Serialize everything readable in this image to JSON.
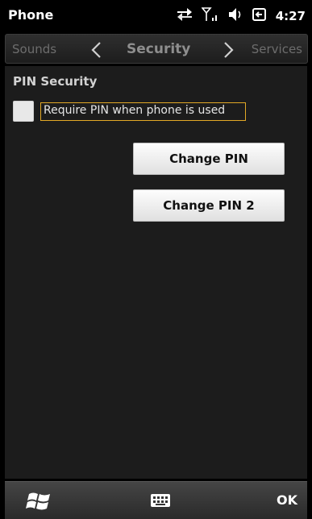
{
  "titlebar": {
    "app_title": "Phone",
    "clock": "4:27",
    "icons": [
      "data-transfer-icon",
      "signal-icon",
      "volume-icon",
      "battery-icon"
    ]
  },
  "tabs": {
    "previous": "Sounds",
    "current": "Security",
    "next": "Services"
  },
  "section": {
    "title": "PIN Security"
  },
  "require_pin": {
    "label": "Require PIN when phone is used",
    "checked": false
  },
  "buttons": {
    "change_pin": "Change PIN",
    "change_pin2": "Change PIN 2"
  },
  "bottombar": {
    "ok_label": "OK"
  },
  "colors": {
    "background": "#000000",
    "content_bg": "#1c1c1c",
    "focus_outline": "#e2a826",
    "button_bg": "#f2f2f2"
  }
}
